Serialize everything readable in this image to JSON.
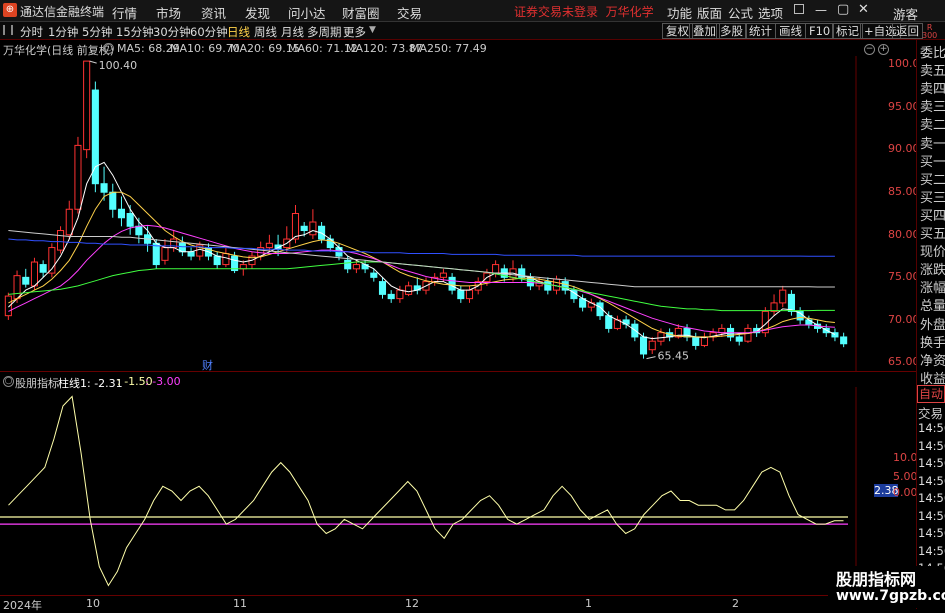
{
  "titlebar": {
    "app_name": "通达信金融终端",
    "menus": [
      "行情",
      "市场",
      "资讯",
      "发现",
      "问小达",
      "财富圈",
      "交易"
    ],
    "broker_status": "证券交易未登录",
    "stock_name": "万华化学",
    "right_menus": [
      "功能",
      "版面",
      "公式",
      "选项"
    ],
    "guest": "游客"
  },
  "periodbar": {
    "periods": [
      "分时",
      "1分钟",
      "5分钟",
      "15分钟",
      "30分钟",
      "60分钟",
      "日线",
      "周线",
      "月线",
      "多周期",
      "更多"
    ],
    "active": "日线",
    "tools": [
      "复权",
      "叠加",
      "多股",
      "统计",
      "画线",
      "F10",
      "标记",
      "+自选",
      "返回"
    ]
  },
  "chart": {
    "title": "万华化学(日线 前复权)",
    "ma": [
      {
        "label": "MA5: 68.29",
        "color": "#ffffff"
      },
      {
        "label": "MA10: 69.70",
        "color": "#ffd24a"
      },
      {
        "label": "MA20: 69.15",
        "color": "#ff40ff"
      },
      {
        "label": "MA60: 71.12",
        "color": "#40ff40"
      },
      {
        "label": "MA120: 73.87",
        "color": "#cccccc"
      },
      {
        "label": "MA250: 77.49",
        "color": "#3050ff"
      }
    ],
    "y_ticks": [
      "100.0",
      "95.00",
      "90.00",
      "85.00",
      "80.00",
      "75.00",
      "70.00",
      "65.00"
    ],
    "high_label": "100.40",
    "low_label": "65.45",
    "finance_marker": "财"
  },
  "indicator": {
    "name": "股朋指标",
    "line_label": "柱线1: -2.31",
    "val2": ": -1.50",
    "val3": ": -3.00",
    "y_ticks": [
      "10.00",
      "5.00",
      "0.00"
    ],
    "current": "2.38"
  },
  "dates": [
    "2024年",
    "10",
    "11",
    "12",
    "1",
    "2"
  ],
  "right_panel": {
    "top": "R\n300",
    "items": [
      "委比",
      "卖五",
      "卖四",
      "卖三",
      "卖二",
      "卖一",
      "买一",
      "买二",
      "买三",
      "买四",
      "买五",
      "现价",
      "涨跌",
      "涨幅",
      "总量",
      "外盘",
      "换手",
      "净资",
      "收益"
    ],
    "mode": "自动",
    "trade": "交易",
    "times": [
      "14:56",
      "14:56",
      "14:56",
      "14:56",
      "14:56",
      "14:56",
      "14:56",
      "14:56",
      "14:56"
    ]
  },
  "watermark": {
    "main": "股朋指标网",
    "url": "www.7gpzb.com"
  },
  "chart_data": {
    "type": "candlestick",
    "ylim": [
      64,
      101
    ],
    "candles": [
      [
        70.5,
        72.8,
        70.0,
        73.2
      ],
      [
        72.5,
        75.2,
        72.0,
        75.8
      ],
      [
        75.0,
        74.2,
        73.8,
        76.0
      ],
      [
        74.0,
        76.8,
        73.5,
        77.3
      ],
      [
        76.5,
        75.6,
        75.0,
        77.0
      ],
      [
        75.5,
        78.5,
        75.0,
        79.0
      ],
      [
        78.2,
        80.5,
        77.8,
        81.0
      ],
      [
        80.0,
        83.0,
        79.5,
        84.0
      ],
      [
        83.0,
        90.5,
        82.5,
        91.5
      ],
      [
        90.0,
        100.4,
        89.0,
        100.4
      ],
      [
        97.0,
        86.0,
        85.0,
        98.0
      ],
      [
        86.0,
        85.0,
        84.0,
        88.0
      ],
      [
        85.0,
        83.0,
        82.0,
        86.0
      ],
      [
        83.0,
        82.0,
        81.0,
        84.5
      ],
      [
        82.5,
        81.0,
        80.0,
        83.5
      ],
      [
        81.0,
        80.0,
        79.0,
        82.0
      ],
      [
        80.0,
        79.0,
        78.0,
        81.0
      ],
      [
        79.0,
        76.5,
        76.0,
        79.5
      ],
      [
        77.0,
        78.5,
        76.5,
        79.5
      ],
      [
        78.5,
        79.5,
        78.0,
        80.5
      ],
      [
        79.0,
        78.0,
        77.5,
        79.8
      ],
      [
        78.0,
        77.5,
        77.0,
        78.5
      ],
      [
        77.5,
        78.8,
        77.0,
        79.2
      ],
      [
        78.5,
        77.5,
        77.0,
        79.0
      ],
      [
        77.5,
        76.5,
        76.0,
        78.0
      ],
      [
        76.5,
        77.8,
        76.2,
        78.5
      ],
      [
        77.5,
        75.8,
        75.5,
        78.0
      ],
      [
        76.0,
        76.5,
        75.2,
        77.0
      ],
      [
        76.5,
        77.5,
        76.0,
        78.0
      ],
      [
        77.5,
        78.5,
        77.0,
        79.2
      ],
      [
        78.5,
        79.0,
        78.0,
        80.0
      ],
      [
        78.8,
        78.3,
        77.5,
        80.0
      ],
      [
        78.5,
        79.5,
        78.0,
        81.0
      ],
      [
        79.5,
        82.5,
        79.0,
        83.5
      ],
      [
        81.0,
        80.5,
        79.8,
        81.5
      ],
      [
        80.0,
        81.5,
        79.5,
        83.0
      ],
      [
        81.0,
        79.5,
        79.0,
        81.5
      ],
      [
        79.5,
        78.5,
        78.0,
        80.0
      ],
      [
        78.5,
        77.5,
        77.0,
        79.0
      ],
      [
        77.0,
        76.0,
        75.5,
        77.5
      ],
      [
        76.0,
        76.5,
        75.5,
        77.0
      ],
      [
        76.5,
        76.0,
        75.5,
        77.0
      ],
      [
        75.5,
        75.0,
        74.5,
        76.0
      ],
      [
        74.5,
        73.0,
        72.5,
        75.0
      ],
      [
        73.0,
        72.5,
        72.0,
        73.5
      ],
      [
        72.5,
        73.5,
        72.0,
        74.0
      ],
      [
        73.0,
        74.0,
        72.8,
        74.5
      ],
      [
        74.0,
        73.5,
        73.0,
        75.0
      ],
      [
        73.5,
        74.5,
        73.0,
        75.0
      ],
      [
        74.5,
        75.0,
        74.0,
        75.5
      ],
      [
        75.0,
        75.5,
        74.5,
        76.0
      ],
      [
        75.0,
        73.5,
        73.0,
        75.5
      ],
      [
        73.5,
        72.5,
        72.0,
        74.0
      ],
      [
        72.5,
        73.5,
        72.0,
        74.0
      ],
      [
        73.5,
        74.5,
        73.0,
        75.0
      ],
      [
        74.5,
        75.5,
        74.0,
        76.0
      ],
      [
        75.5,
        76.5,
        75.0,
        77.0
      ],
      [
        76.0,
        75.0,
        74.5,
        76.5
      ],
      [
        75.0,
        76.0,
        74.5,
        77.0
      ],
      [
        76.0,
        75.0,
        74.5,
        76.5
      ],
      [
        75.0,
        74.0,
        73.5,
        75.5
      ],
      [
        74.0,
        74.5,
        73.5,
        75.0
      ],
      [
        74.5,
        73.5,
        73.0,
        75.0
      ],
      [
        73.5,
        74.8,
        73.0,
        75.2
      ],
      [
        74.5,
        73.5,
        73.0,
        75.0
      ],
      [
        73.5,
        72.5,
        72.0,
        74.0
      ],
      [
        72.5,
        71.5,
        71.0,
        73.0
      ],
      [
        71.5,
        72.0,
        71.0,
        72.5
      ],
      [
        72.0,
        70.5,
        70.0,
        72.3
      ],
      [
        70.5,
        69.0,
        68.5,
        71.0
      ],
      [
        69.0,
        70.0,
        68.8,
        70.5
      ],
      [
        70.0,
        69.5,
        69.0,
        70.5
      ],
      [
        69.5,
        68.0,
        67.5,
        70.0
      ],
      [
        68.0,
        66.0,
        65.45,
        68.5
      ],
      [
        66.5,
        67.5,
        66.0,
        68.0
      ],
      [
        67.5,
        68.5,
        67.0,
        69.0
      ],
      [
        68.5,
        68.0,
        67.5,
        69.0
      ],
      [
        68.0,
        69.0,
        67.8,
        69.5
      ],
      [
        69.0,
        68.0,
        67.5,
        69.5
      ],
      [
        68.0,
        67.0,
        66.5,
        68.5
      ],
      [
        67.0,
        68.0,
        66.8,
        68.5
      ],
      [
        68.0,
        68.5,
        67.5,
        69.0
      ],
      [
        68.5,
        69.0,
        68.0,
        69.5
      ],
      [
        69.0,
        68.0,
        67.5,
        69.5
      ],
      [
        68.0,
        67.5,
        67.0,
        68.5
      ],
      [
        67.5,
        69.0,
        67.3,
        69.5
      ],
      [
        69.0,
        68.5,
        68.0,
        69.5
      ],
      [
        68.5,
        71.0,
        68.0,
        71.5
      ],
      [
        71.0,
        72.0,
        70.5,
        73.0
      ],
      [
        72.0,
        73.5,
        71.5,
        74.0
      ],
      [
        73.0,
        71.0,
        70.5,
        73.5
      ],
      [
        71.0,
        70.0,
        69.5,
        71.5
      ],
      [
        70.0,
        69.5,
        69.0,
        70.5
      ],
      [
        69.5,
        69.0,
        68.5,
        70.0
      ],
      [
        69.0,
        68.5,
        68.0,
        69.5
      ],
      [
        68.5,
        68.0,
        67.5,
        69.0
      ],
      [
        68.0,
        67.2,
        66.8,
        68.5
      ]
    ],
    "ma_series": {
      "MA5": [
        71.5,
        72.5,
        73.5,
        74.0,
        75.0,
        76.0,
        77.5,
        79.5,
        82.0,
        86.0,
        88.0,
        88.5,
        87.0,
        85.0,
        83.0,
        81.5,
        80.5,
        79.0,
        78.5,
        78.5,
        78.0,
        78.0,
        78.3,
        78.0,
        77.5,
        77.3,
        77.0,
        76.8,
        77.0,
        77.5,
        78.0,
        78.5,
        79.0,
        79.8,
        80.0,
        80.5,
        80.2,
        79.5,
        78.5,
        77.5,
        77.0,
        76.5,
        76.0,
        75.0,
        74.0,
        73.5,
        73.3,
        73.5,
        74.0,
        74.5,
        74.5,
        74.0,
        73.5,
        73.5,
        74.0,
        75.0,
        75.5,
        75.5,
        75.5,
        75.2,
        75.0,
        74.5,
        74.2,
        74.0,
        73.8,
        73.2,
        72.5,
        72.0,
        71.5,
        70.5,
        70.0,
        69.5,
        68.8,
        68.0,
        67.8,
        67.9,
        68.0,
        68.2,
        68.2,
        68.0,
        67.9,
        68.1,
        68.3,
        68.5,
        68.4,
        68.4,
        68.6,
        69.5,
        70.5,
        71.3,
        71.2,
        70.8,
        70.0,
        69.4,
        68.8,
        68.29
      ],
      "MA10": [
        72.0,
        72.5,
        73.0,
        73.5,
        74.0,
        74.8,
        75.8,
        77.0,
        78.8,
        81.0,
        83.0,
        84.5,
        85.0,
        85.0,
        84.5,
        83.5,
        82.5,
        81.5,
        80.5,
        79.8,
        79.2,
        78.8,
        78.5,
        78.3,
        78.0,
        77.8,
        77.6,
        77.4,
        77.3,
        77.4,
        77.7,
        78.0,
        78.3,
        78.6,
        78.9,
        79.2,
        79.4,
        79.3,
        79.0,
        78.6,
        78.2,
        77.8,
        77.3,
        76.8,
        76.2,
        75.6,
        75.2,
        74.9,
        74.6,
        74.4,
        74.2,
        74.1,
        74.0,
        74.0,
        74.1,
        74.3,
        74.5,
        74.7,
        74.8,
        74.9,
        74.9,
        74.8,
        74.6,
        74.4,
        74.2,
        73.9,
        73.5,
        73.0,
        72.5,
        72.0,
        71.4,
        70.8,
        70.2,
        69.6,
        69.0,
        68.6,
        68.3,
        68.1,
        68.0,
        68.0,
        68.0,
        68.0,
        68.1,
        68.2,
        68.3,
        68.4,
        68.6,
        68.9,
        69.3,
        69.8,
        70.1,
        70.3,
        70.2,
        70.0,
        69.8,
        69.7
      ],
      "MA20": [
        71.0,
        71.5,
        72.0,
        72.5,
        73.0,
        73.5,
        74.0,
        74.8,
        75.8,
        77.0,
        78.0,
        79.0,
        79.8,
        80.4,
        80.8,
        81.0,
        81.1,
        81.0,
        80.8,
        80.5,
        80.2,
        79.9,
        79.6,
        79.3,
        79.0,
        78.7,
        78.4,
        78.2,
        78.0,
        77.9,
        77.8,
        77.8,
        77.8,
        77.9,
        78.0,
        78.1,
        78.2,
        78.2,
        78.1,
        78.0,
        77.8,
        77.5,
        77.2,
        76.8,
        76.4,
        76.0,
        75.7,
        75.4,
        75.1,
        74.9,
        74.7,
        74.6,
        74.5,
        74.4,
        74.4,
        74.4,
        74.4,
        74.4,
        74.4,
        74.4,
        74.4,
        74.3,
        74.2,
        74.0,
        73.8,
        73.6,
        73.3,
        73.0,
        72.6,
        72.2,
        71.8,
        71.4,
        71.0,
        70.6,
        70.2,
        69.9,
        69.6,
        69.3,
        69.1,
        68.9,
        68.7,
        68.6,
        68.5,
        68.5,
        68.5,
        68.5,
        68.6,
        68.8,
        69.0,
        69.2,
        69.3,
        69.4,
        69.4,
        69.3,
        69.2,
        69.15
      ],
      "MA60": [
        73.0,
        73.1,
        73.2,
        73.3,
        73.4,
        73.5,
        73.6,
        73.8,
        74.0,
        74.3,
        74.6,
        74.9,
        75.2,
        75.4,
        75.6,
        75.8,
        75.9,
        76.0,
        76.0,
        76.0,
        76.0,
        76.0,
        76.0,
        76.0,
        76.0,
        76.0,
        76.0,
        76.0,
        76.0,
        76.0,
        76.0,
        76.0,
        76.0,
        76.1,
        76.2,
        76.3,
        76.4,
        76.5,
        76.6,
        76.7,
        76.8,
        76.8,
        76.8,
        76.8,
        76.7,
        76.6,
        76.5,
        76.4,
        76.3,
        76.2,
        76.1,
        76.0,
        75.9,
        75.8,
        75.7,
        75.6,
        75.4,
        75.2,
        75.0,
        74.8,
        74.6,
        74.4,
        74.2,
        74.0,
        73.8,
        73.6,
        73.4,
        73.2,
        73.0,
        72.8,
        72.6,
        72.4,
        72.2,
        72.0,
        71.8,
        71.6,
        71.5,
        71.4,
        71.3,
        71.3,
        71.2,
        71.2,
        71.1,
        71.1,
        71.1,
        71.1,
        71.1,
        71.1,
        71.1,
        71.1,
        71.1,
        71.1,
        71.1,
        71.12,
        71.12,
        71.12
      ],
      "MA120": [
        80.5,
        80.4,
        80.3,
        80.2,
        80.1,
        80.0,
        79.9,
        79.8,
        79.8,
        79.8,
        79.8,
        79.8,
        79.8,
        79.7,
        79.7,
        79.6,
        79.5,
        79.4,
        79.3,
        79.2,
        79.1,
        79.0,
        78.9,
        78.8,
        78.7,
        78.6,
        78.5,
        78.4,
        78.3,
        78.2,
        78.1,
        78.0,
        77.9,
        77.8,
        77.7,
        77.6,
        77.5,
        77.4,
        77.3,
        77.2,
        77.1,
        77.0,
        76.9,
        76.8,
        76.7,
        76.6,
        76.5,
        76.4,
        76.3,
        76.2,
        76.1,
        76.0,
        75.9,
        75.8,
        75.7,
        75.6,
        75.5,
        75.4,
        75.3,
        75.2,
        75.1,
        75.0,
        74.9,
        74.8,
        74.7,
        74.6,
        74.5,
        74.4,
        74.3,
        74.2,
        74.1,
        74.0,
        73.9,
        73.9,
        73.9,
        73.9,
        73.9,
        73.9,
        73.9,
        73.9,
        73.9,
        73.9,
        73.9,
        73.9,
        73.9,
        73.9,
        73.9,
        73.9,
        73.9,
        73.9,
        73.9,
        73.9,
        73.9,
        73.87,
        73.87,
        73.87
      ],
      "MA250": [
        79.5,
        79.4,
        79.4,
        79.3,
        79.3,
        79.2,
        79.2,
        79.1,
        79.1,
        79.0,
        79.0,
        78.9,
        78.9,
        78.9,
        78.8,
        78.8,
        78.8,
        78.7,
        78.7,
        78.7,
        78.6,
        78.6,
        78.6,
        78.5,
        78.5,
        78.5,
        78.4,
        78.4,
        78.4,
        78.3,
        78.3,
        78.3,
        78.2,
        78.2,
        78.2,
        78.1,
        78.1,
        78.1,
        78.0,
        78.0,
        78.0,
        78.0,
        77.9,
        77.9,
        77.9,
        77.9,
        77.8,
        77.8,
        77.8,
        77.8,
        77.8,
        77.7,
        77.7,
        77.7,
        77.7,
        77.7,
        77.7,
        77.6,
        77.6,
        77.6,
        77.6,
        77.6,
        77.6,
        77.6,
        77.6,
        77.6,
        77.5,
        77.5,
        77.5,
        77.5,
        77.5,
        77.5,
        77.5,
        77.5,
        77.5,
        77.5,
        77.5,
        77.5,
        77.5,
        77.5,
        77.5,
        77.5,
        77.5,
        77.5,
        77.5,
        77.5,
        77.5,
        77.5,
        77.5,
        77.5,
        77.5,
        77.5,
        77.49,
        77.49,
        77.49,
        77.49
      ]
    },
    "indicator_ylim": [
      -18,
      26
    ],
    "indicator_line": [
      1,
      3,
      5,
      7,
      9,
      15,
      22,
      24,
      12,
      -2,
      -12,
      -16,
      -13,
      -8,
      -5,
      -2,
      2,
      5,
      4,
      2,
      4,
      5,
      3,
      0,
      -3,
      -2,
      0,
      2,
      5,
      8,
      10,
      8,
      5,
      2,
      -3,
      -5,
      -4,
      -2,
      -3,
      -4,
      -2,
      0,
      2,
      4,
      6,
      4,
      0,
      -4,
      -6,
      -3,
      -2,
      0,
      2,
      3,
      1,
      -2,
      -3,
      -2,
      -1,
      0,
      3,
      5,
      3,
      0,
      -2,
      -1,
      0,
      -3,
      -5,
      -4,
      -1,
      1,
      3,
      4,
      2,
      2,
      1,
      1,
      1,
      0,
      0,
      2,
      5,
      8,
      9,
      8,
      3,
      -1,
      -2,
      -3,
      -3,
      -2.31,
      -2.31
    ],
    "indicator_hlines": [
      -1.5,
      -3.0
    ]
  }
}
